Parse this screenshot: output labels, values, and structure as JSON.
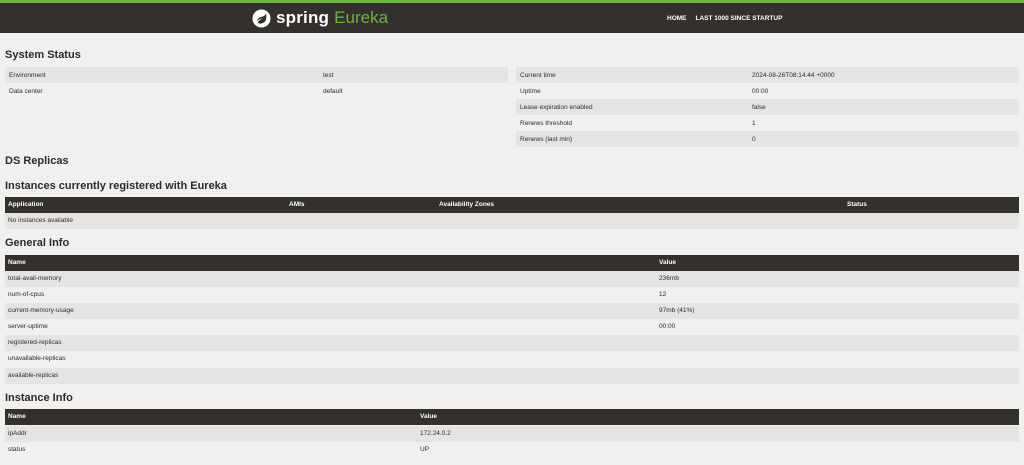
{
  "nav": {
    "brand_spring": "spring",
    "brand_eureka": "Eureka",
    "links": [
      "HOME",
      "LAST 1000 SINCE STARTUP"
    ]
  },
  "system_status": {
    "title": "System Status",
    "left": [
      {
        "label": "Environment",
        "value": "test"
      },
      {
        "label": "Data center",
        "value": "default"
      }
    ],
    "right": [
      {
        "label": "Current time",
        "value": "2024-08-26T08:14:44 +0000"
      },
      {
        "label": "Uptime",
        "value": "00:00"
      },
      {
        "label": "Lease expiration enabled",
        "value": "false"
      },
      {
        "label": "Renews threshold",
        "value": "1"
      },
      {
        "label": "Renews (last min)",
        "value": "0"
      }
    ]
  },
  "ds_replicas": {
    "title": "DS Replicas"
  },
  "instances": {
    "title": "Instances currently registered with Eureka",
    "columns": [
      "Application",
      "AMIs",
      "Availability Zones",
      "Status"
    ],
    "empty_message": "No instances available"
  },
  "general_info": {
    "title": "General Info",
    "columns": [
      "Name",
      "Value"
    ],
    "rows": [
      {
        "name": "total-avail-memory",
        "value": "236mb"
      },
      {
        "name": "num-of-cpus",
        "value": "12"
      },
      {
        "name": "current-memory-usage",
        "value": "97mb (41%)"
      },
      {
        "name": "server-uptime",
        "value": "00:00"
      },
      {
        "name": "registered-replicas",
        "value": ""
      },
      {
        "name": "unavailable-replicas",
        "value": ""
      },
      {
        "name": "available-replicas",
        "value": ""
      }
    ]
  },
  "instance_info": {
    "title": "Instance Info",
    "columns": [
      "Name",
      "Value"
    ],
    "rows": [
      {
        "name": "ipAddr",
        "value": "172.24.0.2"
      },
      {
        "name": "status",
        "value": "UP"
      }
    ]
  },
  "colors": {
    "brand_green": "#6db33f",
    "nav_dark": "#34302d",
    "row_shade": "#e4e4e3",
    "background": "#f0f0ef"
  }
}
